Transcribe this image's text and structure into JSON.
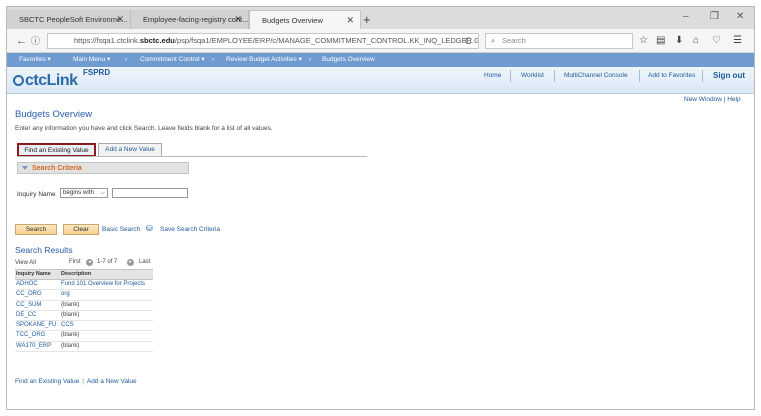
{
  "browser": {
    "tabs": [
      {
        "label": "SBCTC PeopleSoft Environme..."
      },
      {
        "label": "Employee-facing-registry cont..."
      },
      {
        "label": "Budgets Overview"
      }
    ],
    "new_tab": "+",
    "window_controls": [
      "–",
      "❐",
      "✕"
    ],
    "nav": {
      "back": "←",
      "info": "ⓘ",
      "lock": "🔒"
    },
    "url_prefix": "https://fsqa1.ctclink.",
    "url_domain": "sbctc.edu",
    "url_rest": "/psp/fsqa1/EMPLOYEE/ERP/c/MANAGE_COMMITMENT_CONTROL.KK_INQ_LEDGER.GBL?",
    "reload": "C",
    "search_placeholder": "Search",
    "toolbar_icons": [
      "☆",
      "▤",
      "⬇",
      "⌂",
      "♡",
      "☰"
    ]
  },
  "ps_menu": {
    "items": [
      "Favorites ▾",
      "Main Menu ▾",
      "›",
      "Commitment Control ▾",
      "›",
      "Review Budget Activities ▾",
      "›",
      "Budgets Overview"
    ]
  },
  "header": {
    "logo": "ctcLink",
    "env": "FSPRD",
    "links": [
      "Home",
      "Worklist",
      "MultiChannel Console",
      "Add to Favorites"
    ],
    "signout": "Sign out"
  },
  "content": {
    "top_links": "New Window | Help",
    "title": "Budgets Overview",
    "instructions": "Enter any information you have and click Search. Leave fields blank for a list of all values.",
    "tab_find": "Find an Existing Value",
    "tab_add": "Add a New Value",
    "criteria_title": "Search Criteria",
    "inquiry_label": "Inquiry Name",
    "operator": "begins with",
    "inquiry_value": "",
    "search_btn": "Search",
    "clear_btn": "Clear",
    "basic_search": "Basic Search",
    "save_search": "Save Search Criteria",
    "results_title": "Search Results",
    "view_all": "View All",
    "pager_first": "First",
    "pager_range": "1-7 of 7",
    "pager_last": "Last",
    "grid_headers": [
      "Inquiry Name",
      "Description"
    ],
    "rows": [
      {
        "name": "ADHOC",
        "desc": "Fund 101 Overview for Projects"
      },
      {
        "name": "CC_ORG",
        "desc": "org"
      },
      {
        "name": "CC_SUM",
        "desc": "(blank)"
      },
      {
        "name": "DE_CC",
        "desc": "(blank)"
      },
      {
        "name": "SPOKANE_FU",
        "desc": "CCS"
      },
      {
        "name": "TCC_ORG",
        "desc": "(blank)"
      },
      {
        "name": "WA170_ERP",
        "desc": "(blank)"
      }
    ],
    "bottom_find": "Find an Existing Value",
    "bottom_add": "Add a New Value"
  }
}
